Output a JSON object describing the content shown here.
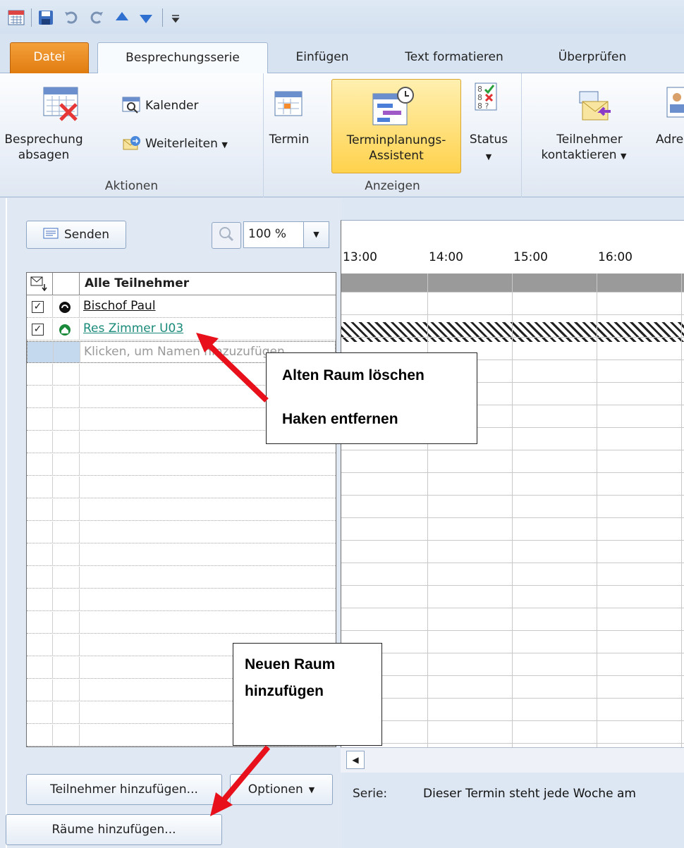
{
  "tabs": {
    "datei": "Datei",
    "serie": "Besprechungsserie",
    "einfuegen": "Einfügen",
    "text": "Text formatieren",
    "pruefen": "Überprüfen"
  },
  "ribbon": {
    "absagen_1": "Besprechung",
    "absagen_2": "absagen",
    "kalender": "Kalender",
    "weiterleiten": "Weiterleiten",
    "aktionen": "Aktionen",
    "termin": "Termin",
    "assistent_1": "Terminplanungs-",
    "assistent_2": "Assistent",
    "status": "Status",
    "anzeigen": "Anzeigen",
    "teilnehmer_1": "Teilnehmer",
    "teilnehmer_2": "kontaktieren",
    "adressbuch": "Adre"
  },
  "toolbar": {
    "senden": "Senden",
    "zoom": "100 %"
  },
  "attendees": {
    "header": "Alle Teilnehmer",
    "rows": [
      {
        "name": "Bischof Paul",
        "checked": true
      },
      {
        "name": "Res Zimmer U03",
        "checked": true
      }
    ],
    "placeholder": "Klicken, um Namen hinzuzufügen"
  },
  "schedule": {
    "times": [
      "13:00",
      "14:00",
      "15:00",
      "16:00"
    ]
  },
  "buttons": {
    "teilnehmer": "Teilnehmer hinzufügen...",
    "optionen": "Optionen",
    "raeume": "Räume hinzufügen..."
  },
  "serie": {
    "label": "Serie:",
    "text": "Dieser Termin steht jede Woche am"
  },
  "annotations": {
    "note1_line1": "Alten Raum löschen",
    "note1_line2": "Haken entfernen",
    "note2_line1": "Neuen Raum",
    "note2_line2": "hinzufügen"
  },
  "colors": {
    "accent_orange": "#e07c10",
    "highlight": "#ffd24d",
    "arrow": "#e8101a",
    "room_green": "#1a8a3a"
  }
}
